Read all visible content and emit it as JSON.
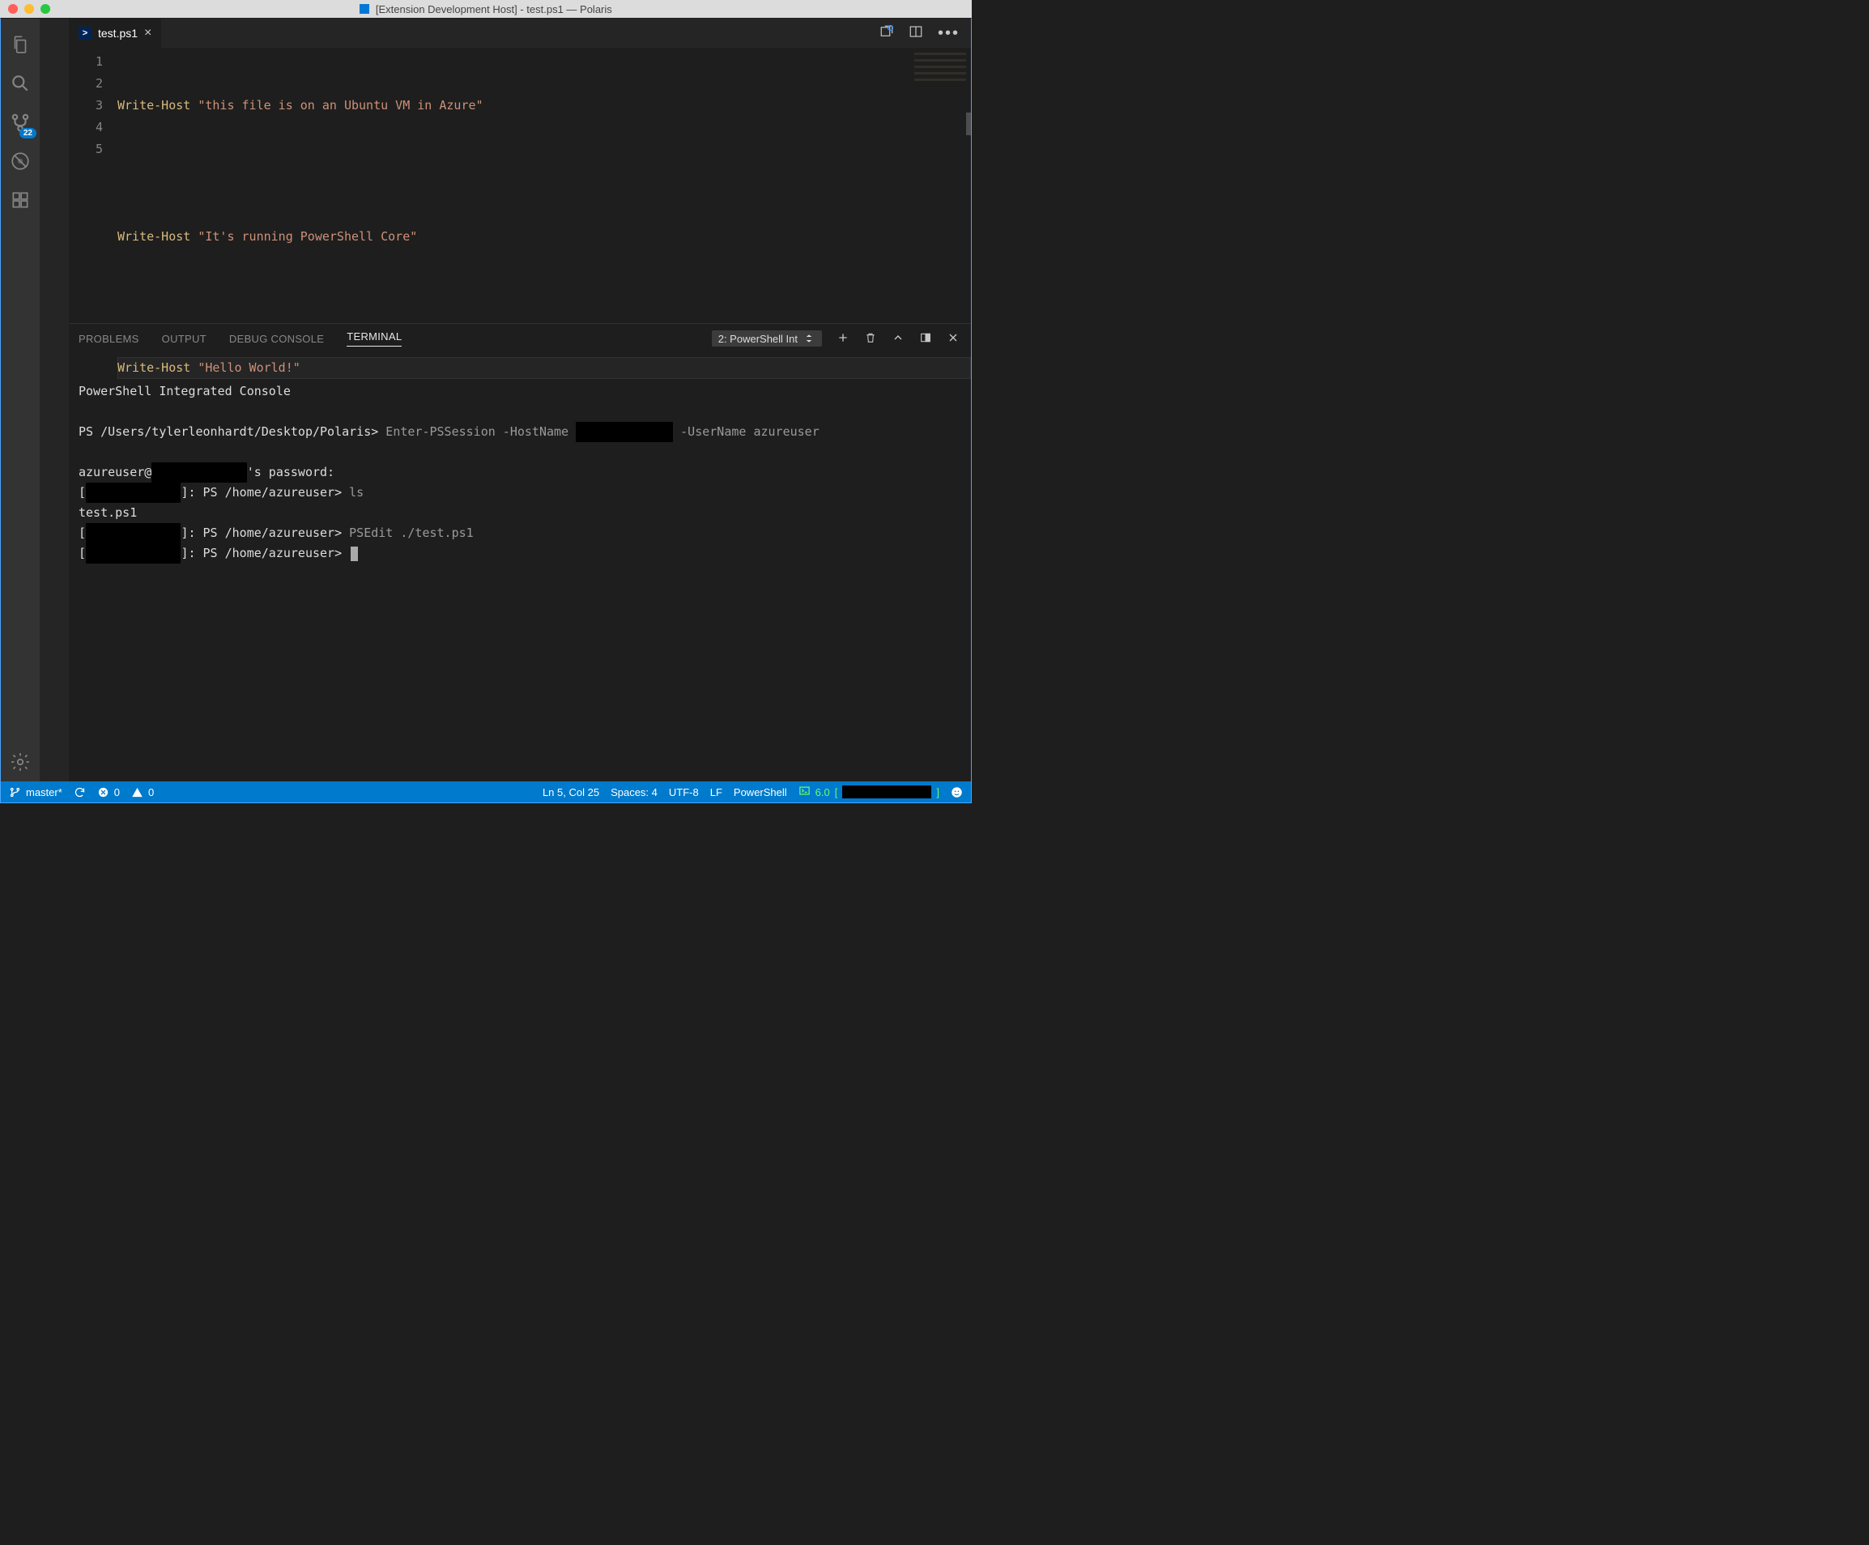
{
  "window": {
    "title": "[Extension Development Host] - test.ps1 — Polaris"
  },
  "activity": {
    "scm_badge": "22"
  },
  "tab": {
    "filename": "test.ps1"
  },
  "editor": {
    "lines": [
      {
        "n": "1",
        "cmd": "Write-Host",
        "str": "\"this file is on an Ubuntu VM in Azure\""
      },
      {
        "n": "2",
        "cmd": "",
        "str": ""
      },
      {
        "n": "3",
        "cmd": "Write-Host",
        "str": "\"It's running PowerShell Core\""
      },
      {
        "n": "4",
        "cmd": "",
        "str": ""
      },
      {
        "n": "5",
        "cmd": "Write-Host",
        "str": "\"Hello World!\"",
        "hl": true
      }
    ]
  },
  "panel": {
    "tabs": {
      "problems": "PROBLEMS",
      "output": "OUTPUT",
      "debug": "DEBUG CONSOLE",
      "terminal": "TERMINAL"
    },
    "terminal_selector": "2: PowerShell Int"
  },
  "terminal": {
    "header": "PowerShell Integrated Console",
    "prompt1_prefix": "PS /Users/tylerleonhardt/Desktop/Polaris>",
    "prompt1_cmd_a": "Enter-PSSession -HostName ",
    "prompt1_cmd_b": " -UserName azureuser",
    "pw_prefix": "azureuser@",
    "pw_suffix": "'s password:",
    "remote_prompt": "]: PS /home/azureuser>",
    "cmd_ls": "ls",
    "ls_out": "test.ps1",
    "cmd_psedit": "PSEdit ./test.ps1"
  },
  "status": {
    "branch": "master*",
    "errors": "0",
    "warnings": "0",
    "ln_col": "Ln 5, Col 25",
    "spaces": "Spaces: 4",
    "encoding": "UTF-8",
    "eol": "LF",
    "lang": "PowerShell",
    "ps_version": "6.0"
  }
}
